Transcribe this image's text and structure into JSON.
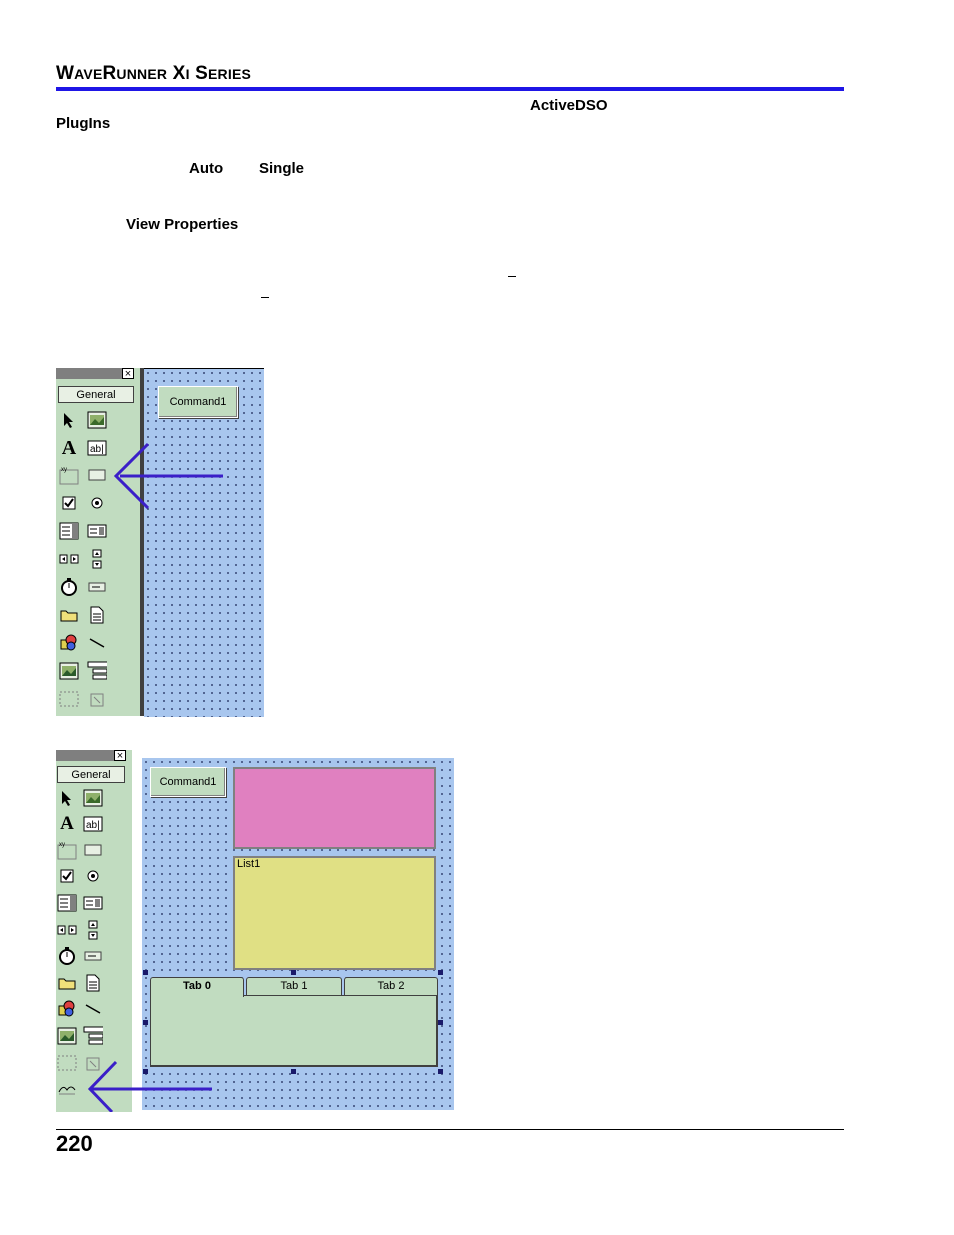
{
  "header": {
    "series_first": "W",
    "series_rest1": "AVE",
    "series_r": "R",
    "series_rest2": "UNNER",
    "xi_x": " X",
    "xi_i": "I",
    "series_s": " S",
    "series_rest3": "ERIES"
  },
  "body_text": {
    "activedso": "ActiveDSO",
    "plugins": "PlugIns",
    "auto": "Auto",
    "single": "Single",
    "view_properties": "View Properties"
  },
  "figure1": {
    "toolbox_tab": "General",
    "close_glyph": "×",
    "command_button": "Command1"
  },
  "figure2": {
    "toolbox_tab": "General",
    "close_glyph": "×",
    "command_button": "Command1",
    "list_label": "List1",
    "tabs": [
      "Tab 0",
      "Tab 1",
      "Tab 2"
    ]
  },
  "footer": {
    "page_number": "220"
  },
  "colors": {
    "accent_rule": "#1f16e6",
    "arrow": "#3a1fc8",
    "toolbox": "#c1dcc0",
    "form_bg": "#a8c6ee",
    "pink_box": "#e080c0",
    "yellow_list": "#e0e084"
  }
}
